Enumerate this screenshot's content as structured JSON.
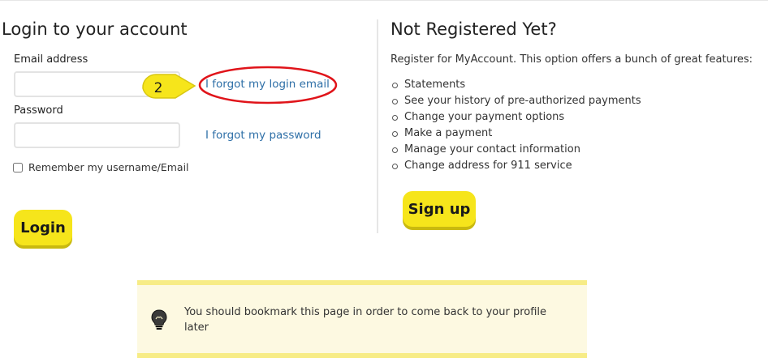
{
  "login": {
    "title": "Login to your account",
    "email_label": "Email address",
    "email_value": "",
    "email_placeholder": "",
    "password_label": "Password",
    "password_value": "",
    "forgot_email_link": "I forgot my login email",
    "forgot_password_link": "I forgot my password",
    "remember_label": "Remember my username/Email",
    "remember_checked": false,
    "login_button": "Login"
  },
  "register": {
    "title": "Not Registered Yet?",
    "description": "Register for MyAccount. This option offers a bunch of great features:",
    "features": [
      "Statements",
      "See your history of pre-authorized payments",
      "Change your payment options",
      "Make a payment",
      "Manage your contact information",
      "Change address for 911 service"
    ],
    "signup_button": "Sign up"
  },
  "notice": {
    "icon": "lightbulb-icon",
    "text": "You should bookmark this page in order to come back to your profile later"
  },
  "annotation": {
    "step_number": "2",
    "badge_color": "#f6e51b",
    "highlight_color": "#e0141a"
  },
  "colors": {
    "accent_yellow": "#f6e51b",
    "link_blue": "#2e6fa7",
    "notice_bg": "#fdf9e1",
    "notice_border": "#f7ec86"
  }
}
